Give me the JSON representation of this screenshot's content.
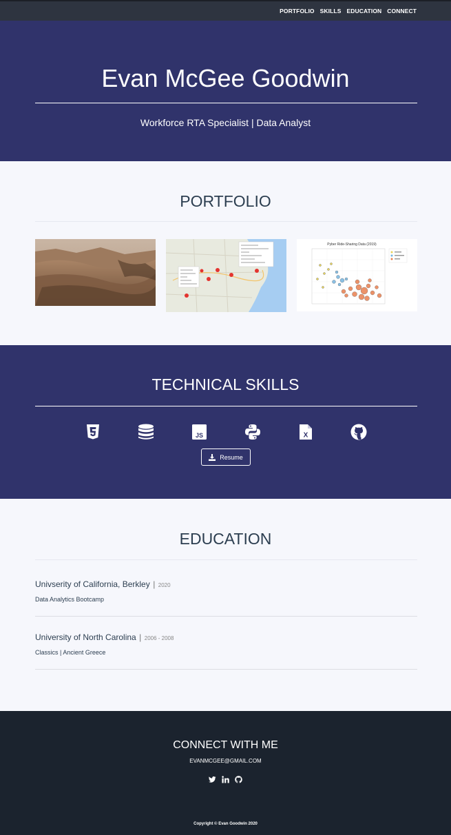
{
  "nav": {
    "items": [
      "PORTFOLIO",
      "SKILLS",
      "EDUCATION",
      "CONNECT"
    ]
  },
  "hero": {
    "name": "Evan McGee Goodwin",
    "tagline": "Workforce RTA Specialist | Data Analyst"
  },
  "portfolio": {
    "title": "PORTFOLIO",
    "thumbnails": [
      "mars-landscape-photo",
      "map-with-markers",
      "pyber-bubble-chart"
    ],
    "chart_thumbnail_title": "Pyber Ride-Sharing Data (2019)"
  },
  "skills": {
    "title": "TECHNICAL SKILLS",
    "icons": [
      "html5-icon",
      "database-icon",
      "javascript-icon",
      "python-icon",
      "excel-icon",
      "github-icon"
    ],
    "resume_label": "Resume"
  },
  "education": {
    "title": "EDUCATION",
    "items": [
      {
        "school": "Univserity of California, Berkley",
        "separator": "|",
        "year": "2020",
        "program": "Data Analytics Bootcamp"
      },
      {
        "school": "University of North Carolina",
        "separator": "|",
        "year": "2006 - 2008",
        "program": "Classics | Ancient Greece"
      }
    ]
  },
  "footer": {
    "title": "CONNECT WITH ME",
    "email": "EVANMCGEE@GMAIL.COM",
    "social": [
      "twitter-icon",
      "linkedin-icon",
      "github-icon"
    ],
    "copyright": "Copyright © Evan Goodwin 2020"
  },
  "colors": {
    "nav_bg": "#2e3440",
    "hero_bg": "#30336b",
    "section_light": "#f6f7fc",
    "footer_bg": "#1b232e",
    "text_dark": "#2c3e50"
  }
}
